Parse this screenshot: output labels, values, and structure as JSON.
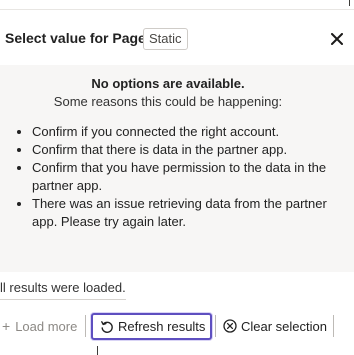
{
  "dialog": {
    "title": "Select value for Page",
    "badge": "Static",
    "close_icon": "close-icon"
  },
  "notice": {
    "title": "No options are available.",
    "subtitle": "Some reasons this could be happening:",
    "reasons": [
      "Confirm if you connected the right account.",
      "Confirm that there is data in the partner app.",
      "Confirm that you have permission to the data in the partner app.",
      "There was an issue retrieving data from the partner app. Please try again later."
    ]
  },
  "results": {
    "status": "ll results were loaded."
  },
  "footer": {
    "load_more_label": "Load more",
    "load_more_icon": "plus-icon",
    "refresh_label": "Refresh results",
    "refresh_icon": "refresh-icon",
    "clear_label": "Clear selection",
    "clear_icon": "clear-circle-icon",
    "accent_color": "#5e4fc0"
  }
}
